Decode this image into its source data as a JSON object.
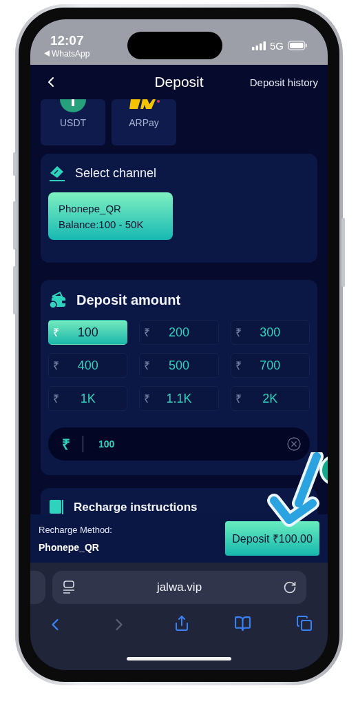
{
  "status_bar": {
    "time": "12:07",
    "back_app": "WhatsApp",
    "network": "5G"
  },
  "header": {
    "title": "Deposit",
    "history_link": "Deposit history"
  },
  "payment_methods": [
    {
      "kind": "coin",
      "label": "USDT",
      "selected": false
    },
    {
      "kind": "brand",
      "label": "ARPay",
      "selected": false
    }
  ],
  "select_channel": {
    "title": "Select channel",
    "channels": [
      {
        "name": "Phonepe_QR",
        "balance": "Balance:100 - 50K",
        "selected": true
      }
    ]
  },
  "deposit_amount": {
    "title": "Deposit amount",
    "presets": [
      {
        "symbol": "₹",
        "amount": "100",
        "selected": true
      },
      {
        "symbol": "₹",
        "amount": "200",
        "selected": false
      },
      {
        "symbol": "₹",
        "amount": "300",
        "selected": false
      },
      {
        "symbol": "₹",
        "amount": "400",
        "selected": false
      },
      {
        "symbol": "₹",
        "amount": "500",
        "selected": false
      },
      {
        "symbol": "₹",
        "amount": "700",
        "selected": false
      },
      {
        "symbol": "₹",
        "amount": "1K",
        "selected": false
      },
      {
        "symbol": "₹",
        "amount": "1.1K",
        "selected": false
      },
      {
        "symbol": "₹",
        "amount": "2K",
        "selected": false
      }
    ],
    "input": {
      "symbol": "₹",
      "value": "100"
    }
  },
  "instructions": {
    "title": "Recharge instructions"
  },
  "footer": {
    "method_label": "Recharge Method:",
    "method_value": "Phonepe_QR",
    "button": "Deposit ₹100.00"
  },
  "browser": {
    "url": "jalwa.vip",
    "toolbar": [
      {
        "kind": "back",
        "disabled": false
      },
      {
        "kind": "forward",
        "disabled": true
      },
      {
        "kind": "share",
        "disabled": false
      },
      {
        "kind": "bookmarks",
        "disabled": false
      },
      {
        "kind": "tabs",
        "disabled": false
      }
    ]
  }
}
